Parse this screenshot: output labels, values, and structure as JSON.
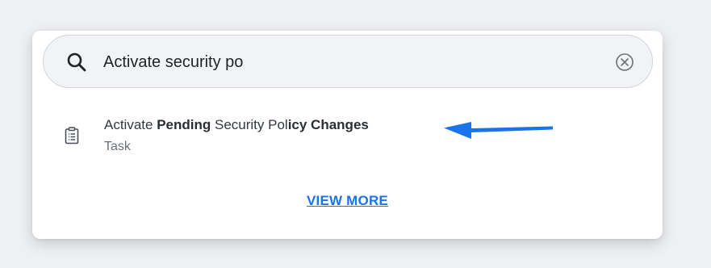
{
  "search": {
    "value": "Activate security po",
    "icon": "search-icon",
    "clear_icon": "clear-icon"
  },
  "results": [
    {
      "title_parts": [
        {
          "text": "Activate ",
          "bold": false
        },
        {
          "text": "Pending",
          "bold": true
        },
        {
          "text": " Security Pol",
          "bold": false
        },
        {
          "text": "icy Changes",
          "bold": true
        }
      ],
      "subtitle": "Task",
      "icon": "clipboard-icon"
    }
  ],
  "view_more": "VIEW MORE",
  "colors": {
    "accent": "#1a73e8",
    "arrow": "#1a73e8",
    "background": "#eef0f3"
  }
}
